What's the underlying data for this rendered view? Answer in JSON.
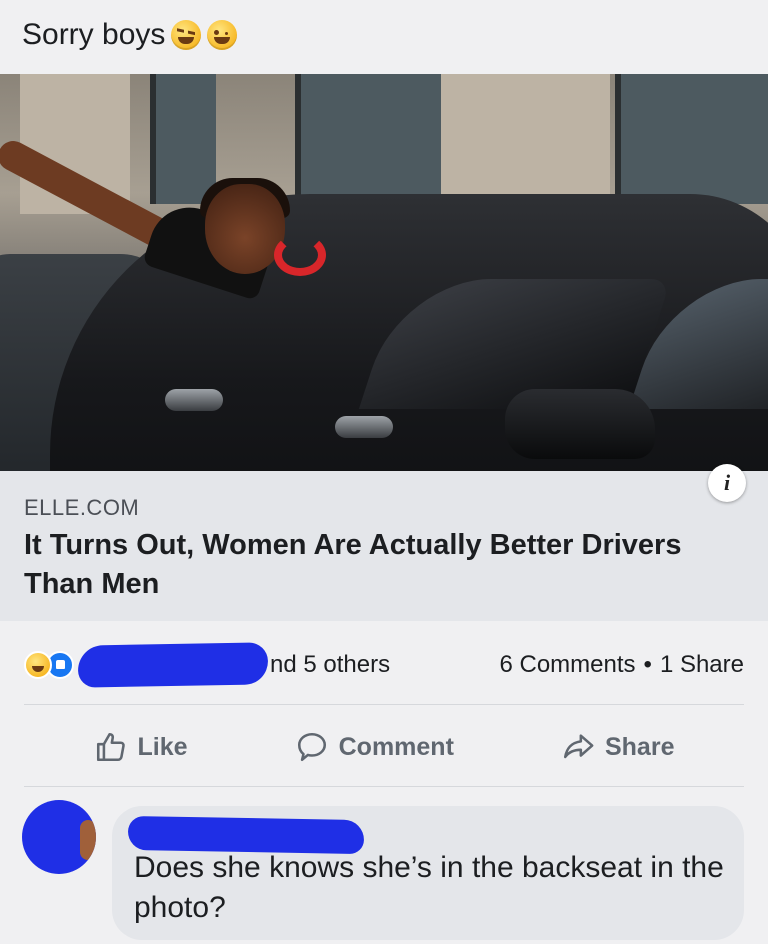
{
  "post": {
    "text": "Sorry boys",
    "emojis": [
      "grinning-squinting-face",
      "winking-face"
    ]
  },
  "link_preview": {
    "domain": "ELLE.COM",
    "headline": "It Turns Out, Women Are Actually Better Drivers Than Men",
    "info_icon": "i"
  },
  "reactions": {
    "icons": [
      "haha-reaction-icon",
      "like-reaction-icon"
    ],
    "others_text": "nd 5 others",
    "comments_count": "6 Comments",
    "separator": "•",
    "shares_count": "1 Share"
  },
  "actions": {
    "like_label": "Like",
    "comment_label": "Comment",
    "share_label": "Share"
  },
  "comment": {
    "text": "Does she knows she’s in the backseat in the photo?"
  },
  "colors": {
    "background": "#f0f0f2",
    "link_box": "#e4e6ea",
    "redaction_scribble": "#1f2fe6",
    "action_text": "#606770",
    "like_blue": "#1877f2"
  }
}
